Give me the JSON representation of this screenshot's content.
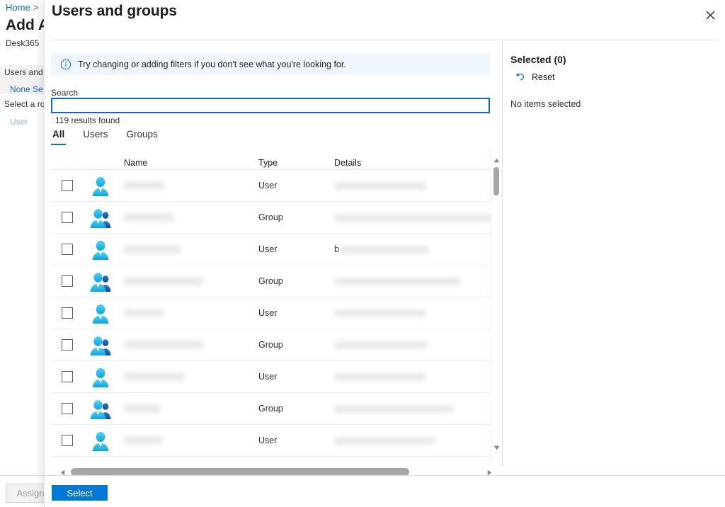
{
  "background": {
    "breadcrumb_home": "Home",
    "breadcrumb_separator": ">",
    "page_title": "Add A",
    "subtitle": "Desk365",
    "field_label": "Users and",
    "field_value": "None Se",
    "field_label2": "Select a ro",
    "field_value2": "User",
    "assign_button": "Assign"
  },
  "panel": {
    "title": "Users and groups",
    "close_icon": "close-icon",
    "info_banner": {
      "icon": "info-circle-icon",
      "text": "Try changing or adding filters if you don't see what you're looking for."
    },
    "search": {
      "label": "Search",
      "value": "",
      "placeholder": ""
    },
    "results_count": "119 results found",
    "tabs": [
      {
        "label": "All",
        "active": true
      },
      {
        "label": "Users",
        "active": false
      },
      {
        "label": "Groups",
        "active": false
      }
    ],
    "table": {
      "columns": [
        "Name",
        "Type",
        "Details"
      ],
      "rows": [
        {
          "type": "User",
          "icon": "user-icon",
          "name_redacted_width": 58,
          "details_prefix": "",
          "details_redacted_width": 130
        },
        {
          "type": "Group",
          "icon": "group-icon",
          "name_redacted_width": 70,
          "details_prefix": "",
          "details_redacted_width": 230
        },
        {
          "type": "User",
          "icon": "user-icon",
          "name_redacted_width": 80,
          "details_prefix": "b",
          "details_redacted_width": 126
        },
        {
          "type": "Group",
          "icon": "group-icon",
          "name_redacted_width": 112,
          "details_prefix": "",
          "details_redacted_width": 178
        },
        {
          "type": "User",
          "icon": "user-icon",
          "name_redacted_width": 56,
          "details_prefix": "",
          "details_redacted_width": 130
        },
        {
          "type": "Group",
          "icon": "group-icon",
          "name_redacted_width": 112,
          "details_prefix": "",
          "details_redacted_width": 132
        },
        {
          "type": "User",
          "icon": "user-icon",
          "name_redacted_width": 86,
          "details_prefix": "",
          "details_redacted_width": 130
        },
        {
          "type": "Group",
          "icon": "group-icon",
          "name_redacted_width": 52,
          "details_prefix": "",
          "details_redacted_width": 168
        },
        {
          "type": "User",
          "icon": "user-icon",
          "name_redacted_width": 54,
          "details_prefix": "",
          "details_redacted_width": 142
        }
      ]
    },
    "scrollbars": {
      "vertical_up_icon": "chevron-up-icon",
      "vertical_down_icon": "chevron-down-icon",
      "horizontal_left_icon": "chevron-left-icon",
      "horizontal_right_icon": "chevron-right-icon"
    },
    "selected_pane": {
      "title": "Selected (0)",
      "reset_label": "Reset",
      "reset_icon": "undo-arrow-icon",
      "empty_text": "No items selected"
    },
    "footer": {
      "select_button": "Select"
    }
  },
  "colors": {
    "accent": "#0078d4",
    "link": "#0f6cbd",
    "info_bg": "#eff6fc",
    "avatar_cyan": "#2fb8e8",
    "avatar_blue": "#1b5fa8"
  }
}
